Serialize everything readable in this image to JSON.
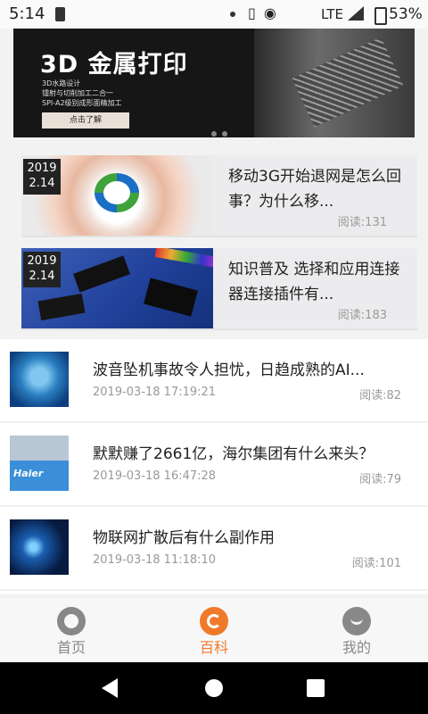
{
  "status_bar": {
    "time": "5:14",
    "network": "LTE",
    "battery": "53%"
  },
  "banner": {
    "title": "3D 金属打印",
    "bullets": [
      "3D水路设计",
      "镭射与切削加工二合一",
      "SPI-A2级别成形面精加工"
    ],
    "cta": "点击了解"
  },
  "featured": [
    {
      "date_year": "2019",
      "date_day": "2.14",
      "title": "移动3G开始退网是怎么回事？为什么移...",
      "reads": "阅读:131"
    },
    {
      "date_year": "2019",
      "date_day": "2.14",
      "title": "知识普及 选择和应用连接器连接插件有...",
      "reads": "阅读:183"
    }
  ],
  "articles": [
    {
      "title": "波音坠机事故令人担忧，日趋成熟的AI...",
      "time": "2019-03-18 17:19:21",
      "reads": "阅读:82"
    },
    {
      "title": "默默赚了2661亿，海尔集团有什么来头？",
      "time": "2019-03-18 16:47:28",
      "reads": "阅读:79",
      "thumb_text": "Haier"
    },
    {
      "title": "物联网扩散后有什么副作用",
      "time": "2019-03-18 11:18:10",
      "reads": "阅读:101"
    }
  ],
  "tabs": [
    {
      "label": "首页",
      "color": "#888888"
    },
    {
      "label": "百科",
      "color": "#f07a2a"
    },
    {
      "label": "我的",
      "color": "#888888"
    }
  ]
}
